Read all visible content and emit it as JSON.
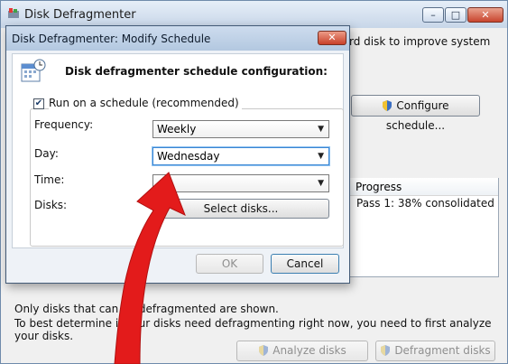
{
  "main_window": {
    "title": "Disk Defragmenter",
    "caption_buttons": {
      "minimize": "–",
      "maximize": "□",
      "close": "✕"
    },
    "description_fragment": "rd disk to improve system",
    "configure_button": "Configure schedule...",
    "table": {
      "progress_header": "Progress",
      "progress_value": "Pass 1: 38% consolidated"
    },
    "footer_line1": "Only disks that can be defragmented are shown.",
    "footer_line2": "To best determine if your disks need defragmenting right now, you need to first analyze your disks.",
    "analyze_button": "Analyze disks",
    "defragment_button": "Defragment disks"
  },
  "dialog": {
    "title": "Disk Defragmenter: Modify Schedule",
    "close_glyph": "✕",
    "heading": "Disk defragmenter schedule configuration:",
    "run_on_schedule_label": "Run on a schedule (recommended)",
    "run_on_schedule_checked": true,
    "frequency_label": "Frequency:",
    "frequency_value": "Weekly",
    "day_label": "Day:",
    "day_value": "Wednesday",
    "time_label": "Time:",
    "time_value": "",
    "disks_label": "Disks:",
    "select_disks_button": "Select disks...",
    "ok_button": "OK",
    "cancel_button": "Cancel"
  },
  "colors": {
    "arrow": "#e31b1b",
    "focus": "#3a86d4"
  }
}
